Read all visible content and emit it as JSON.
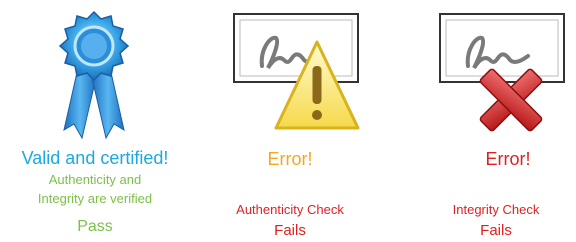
{
  "colors": {
    "cyan": "#1aa9e0",
    "green": "#7cc04a",
    "orange": "#f5a623",
    "red": "#e02020"
  },
  "icons": [
    "award-ribbon-icon",
    "warning-triangle-icon",
    "red-x-icon"
  ],
  "panels": {
    "valid": {
      "headline": "Valid and certified!",
      "line1": "Authenticity and",
      "line2": "Integrity are verified",
      "result": "Pass"
    },
    "auth_error": {
      "headline": "Error!",
      "check": "Authenticity Check",
      "result": "Fails"
    },
    "integrity_error": {
      "headline": "Error!",
      "check": "Integrity Check",
      "result": "Fails"
    }
  }
}
